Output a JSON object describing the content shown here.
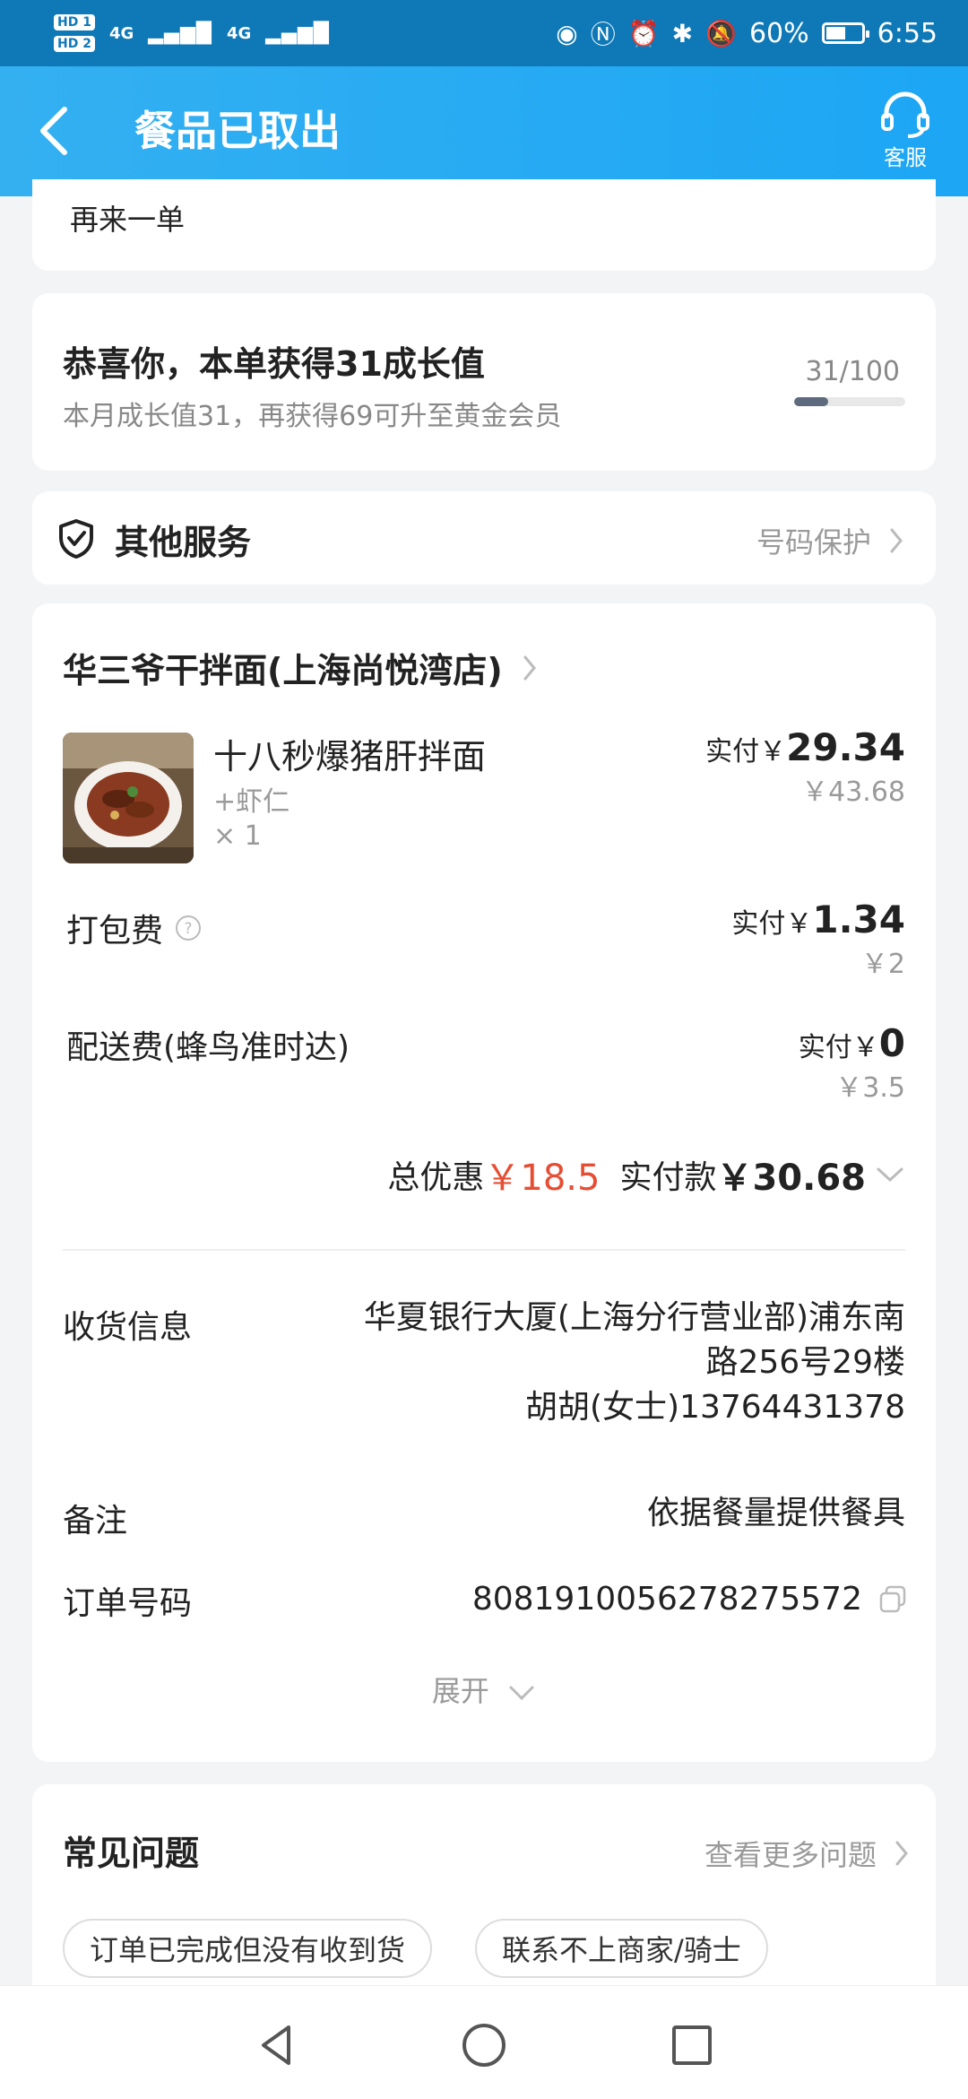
{
  "status_bar": {
    "hd1": "HD 1",
    "hd2": "HD 2",
    "net1": "4G",
    "net2": "4G",
    "battery": "60%",
    "battery_level": 0.6,
    "time": "6:55"
  },
  "header": {
    "title": "餐品已取出",
    "service_label": "客服"
  },
  "reorder": {
    "label": "再来一单"
  },
  "growth": {
    "title": "恭喜你，本单获得31成长值",
    "subtitle": "本月成长值31，再获得69可升至黄金会员",
    "progress_text": "31/100",
    "progress": 0.31
  },
  "other_services": {
    "title": "其他服务",
    "link": "号码保护"
  },
  "order": {
    "shop_name": "华三爷干拌面(上海尚悦湾店)",
    "item": {
      "name": "十八秒爆猪肝拌面",
      "option": "+虾仁",
      "qty": "× 1",
      "paid_label": "实付￥",
      "paid_value": "29.34",
      "original": "￥43.68"
    },
    "packing": {
      "label": "打包费",
      "paid_label": "实付￥",
      "paid_value": "1.34",
      "original": "￥2"
    },
    "delivery": {
      "label": "配送费(蜂鸟准时达)",
      "paid_label": "实付￥",
      "paid_value": "0",
      "original": "￥3.5"
    },
    "total": {
      "discount_label": "总优惠",
      "discount_value": "￥18.5",
      "paid_label": "实付款",
      "paid_value": "￥30.68"
    },
    "address": {
      "label": "收货信息",
      "line1": "华夏银行大厦(上海分行营业部)浦东南",
      "line2": "路256号29楼",
      "line3": "胡胡(女士)13764431378"
    },
    "note": {
      "label": "备注",
      "value": "依据餐量提供餐具"
    },
    "order_no": {
      "label": "订单号码",
      "value": "8081910056278275572"
    },
    "expand_label": "展开"
  },
  "faq": {
    "title": "常见问题",
    "more": "查看更多问题",
    "chips": [
      "订单已完成但没有收到货",
      "联系不上商家/骑士"
    ]
  },
  "colors": {
    "header": "#1ca6f4",
    "status_bar": "#0f79b8",
    "discount": "#e64e34"
  }
}
